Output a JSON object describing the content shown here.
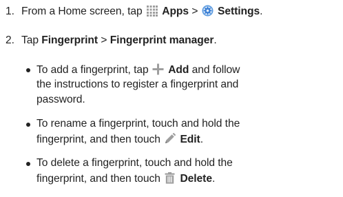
{
  "steps": [
    {
      "number": "1.",
      "pre": "From a Home screen, tap",
      "apps": "Apps",
      "sep": ">",
      "settings": "Settings",
      "end": "."
    },
    {
      "number": "2.",
      "pre": "Tap",
      "fingerprint": "Fingerprint",
      "sep": ">",
      "manager": "Fingerprint manager",
      "end": "."
    }
  ],
  "bullets": [
    {
      "l1_pre": "To add a fingerprint, tap",
      "l1_bold": "Add",
      "l1_post": "and follow",
      "l2": "the instructions to register a fingerprint and",
      "l3": "password."
    },
    {
      "l1": "To rename a fingerprint, touch and hold the",
      "l2_pre": "fingerprint, and then touch",
      "l2_bold": "Edit",
      "l2_end": "."
    },
    {
      "l1": "To delete a fingerprint, touch and hold the",
      "l2_pre": "fingerprint, and then touch",
      "l2_bold": "Delete",
      "l2_end": "."
    }
  ],
  "icons": {
    "apps": "apps-grid-icon",
    "settings": "settings-gear-icon",
    "add": "plus-icon",
    "edit": "pencil-icon",
    "delete": "trash-icon",
    "icon_color": "#9e9e9e",
    "gear_color": "#3b7fd4"
  }
}
